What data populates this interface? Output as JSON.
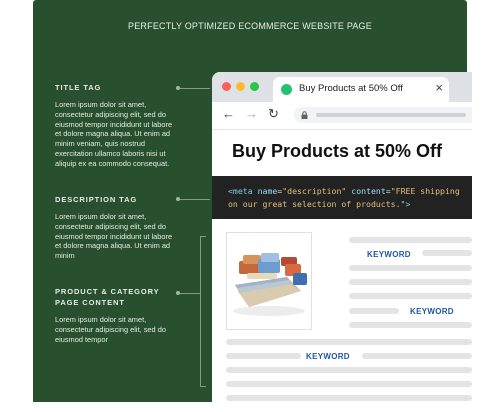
{
  "page": {
    "title": "PERFECTLY OPTIMIZED ECOMMERCE WEBSITE PAGE"
  },
  "sections": [
    {
      "heading": "TITLE TAG",
      "text": "Lorem ipsum dolor sit amet, consectetur adipiscing elit, sed do eiusmod tempor incididunt ut labore et dolore magna aliqua. Ut enim ad minim veniam, quis nostrud exercitation ullamco laboris nisi ut aliquip ex ea commodo consequat."
    },
    {
      "heading": "DESCRIPTION TAG",
      "text": "Lorem ipsum dolor sit amet, consectetur adipiscing elit, sed do eiusmod tempor incididunt ut labore et dolore magna aliqua. Ut enim ad minim"
    },
    {
      "heading": "PRODUCT & CATEGORY PAGE CONTENT",
      "text": "Lorem ipsum dolor sit amet, consectetur adipiscing elit, sed do eiusmod tempor"
    }
  ],
  "browser": {
    "tab_title": "Buy Products at 50% Off",
    "close_glyph": "×",
    "back_glyph": "←",
    "forward_glyph": "→",
    "reload_glyph": "↻",
    "heading": "Buy Products at 50% Off",
    "meta": {
      "open": "<meta",
      "attr_name": "name",
      "val_name": "\"description\"",
      "attr_content": "content",
      "val_content_1": "\"FREE shipping",
      "val_content_2": "on our great selection of products.\"",
      "close": ">",
      "eq": "="
    },
    "keywords": [
      "KEYWORD",
      "KEYWORD",
      "KEYWORD"
    ]
  },
  "colors": {
    "panel": "#284f2e",
    "keyword": "#2155a6",
    "favicon": "#24c174",
    "traffic_red": "#ff5f57",
    "traffic_yellow": "#febc2e",
    "traffic_green": "#28c840"
  }
}
